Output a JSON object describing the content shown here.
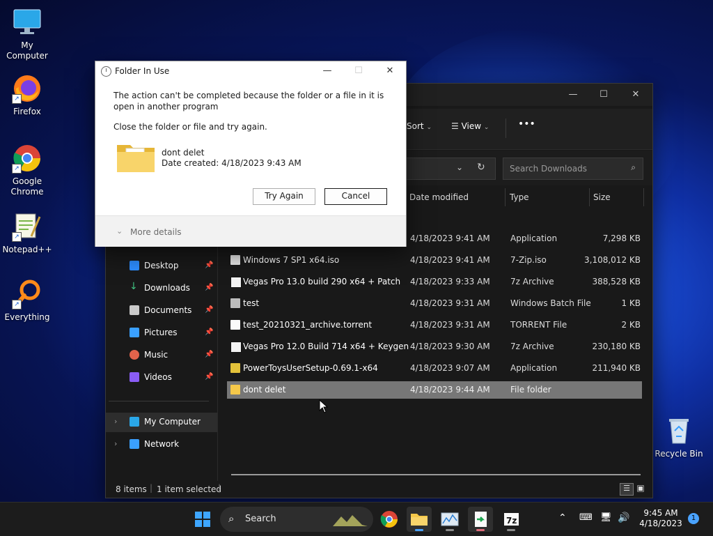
{
  "desktop": {
    "icons": [
      {
        "label": "My Computer"
      },
      {
        "label": "Firefox"
      },
      {
        "label": "Google Chrome"
      },
      {
        "label": "Notepad++"
      },
      {
        "label": "Everything"
      },
      {
        "label": "Recycle Bin"
      }
    ]
  },
  "explorer": {
    "toolbar": {
      "sort_label": "Sort",
      "view_label": "View",
      "more_label": "•••"
    },
    "search_placeholder": "Search Downloads",
    "columns": {
      "date": "Date modified",
      "type": "Type",
      "size": "Size"
    },
    "sidebar": [
      {
        "label": "Desktop",
        "icon_color": "#2d8cff"
      },
      {
        "label": "Downloads",
        "icon_color": "#3fbf7f"
      },
      {
        "label": "Documents",
        "icon_color": "#c9c9c9"
      },
      {
        "label": "Pictures",
        "icon_color": "#3aa0ff"
      },
      {
        "label": "Music",
        "icon_color": "#e2634b"
      },
      {
        "label": "Videos",
        "icon_color": "#8a5cf6"
      }
    ],
    "tree": [
      {
        "label": "My Computer"
      },
      {
        "label": "Network"
      }
    ],
    "files": [
      {
        "name": "",
        "date": "4/18/2023 9:41 AM",
        "type": "Application",
        "size": "7,298 KB"
      },
      {
        "name": "Windows 7 SP1 x64.iso",
        "date": "4/18/2023 9:41 AM",
        "type": "7-Zip.iso",
        "size": "3,108,012 KB"
      },
      {
        "name": "Vegas Pro 13.0 build 290 x64 + Patch",
        "date": "4/18/2023 9:33 AM",
        "type": "7z Archive",
        "size": "388,528 KB"
      },
      {
        "name": "test",
        "date": "4/18/2023 9:31 AM",
        "type": "Windows Batch File",
        "size": "1 KB"
      },
      {
        "name": "test_20210321_archive.torrent",
        "date": "4/18/2023 9:31 AM",
        "type": "TORRENT File",
        "size": "2 KB"
      },
      {
        "name": "Vegas Pro 12.0 Build 714 x64 + Keygen",
        "date": "4/18/2023 9:30 AM",
        "type": "7z Archive",
        "size": "230,180 KB"
      },
      {
        "name": "PowerToysUserSetup-0.69.1-x64",
        "date": "4/18/2023 9:07 AM",
        "type": "Application",
        "size": "211,940 KB"
      },
      {
        "name": "dont delet",
        "date": "4/18/2023 9:44 AM",
        "type": "File folder",
        "size": ""
      }
    ],
    "status": {
      "items": "8 items",
      "selected": "1 item selected"
    }
  },
  "dialog": {
    "title": "Folder In Use",
    "message": "The action can't be completed because the folder or a file in it is open in another program",
    "instruction": "Close the folder or file and try again.",
    "folder_name": "dont delet",
    "folder_date": "Date created: 4/18/2023 9:43 AM",
    "try_again": "Try Again",
    "cancel": "Cancel",
    "more_details": "More details"
  },
  "taskbar": {
    "search_placeholder": "Search",
    "time": "9:45 AM",
    "date": "4/18/2023",
    "notification_count": "1"
  }
}
